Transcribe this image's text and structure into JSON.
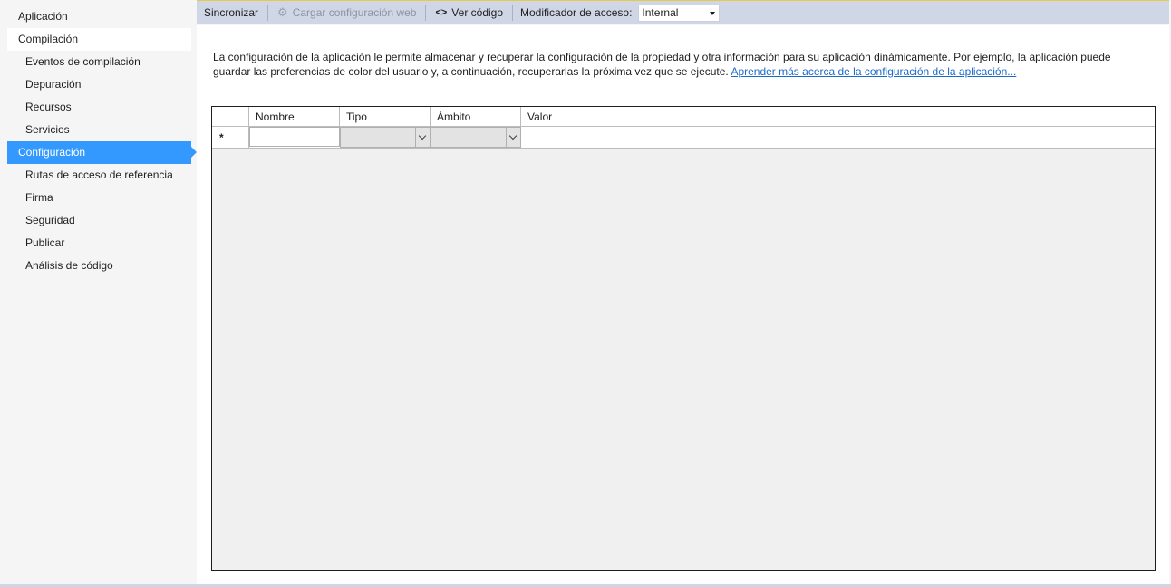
{
  "sidebar": {
    "items": [
      {
        "label": "Aplicación"
      },
      {
        "label": "Compilación"
      },
      {
        "label": "Eventos de compilación"
      },
      {
        "label": "Depuración"
      },
      {
        "label": "Recursos"
      },
      {
        "label": "Servicios"
      },
      {
        "label": "Configuración"
      },
      {
        "label": "Rutas de acceso de referencia"
      },
      {
        "label": "Firma"
      },
      {
        "label": "Seguridad"
      },
      {
        "label": "Publicar"
      },
      {
        "label": "Análisis de código"
      }
    ],
    "selected": "Configuración"
  },
  "toolbar": {
    "sync_label": "Sincronizar",
    "load_web_label": "Cargar configuración web",
    "view_code_icon": "<>",
    "view_code_label": "Ver código",
    "access_modifier_label": "Modificador de acceso:",
    "access_modifier_value": "Internal"
  },
  "description": {
    "text": "La configuración de la aplicación le permite almacenar y recuperar la configuración de la propiedad y otra información para su aplicación dinámicamente. Por ejemplo, la aplicación puede guardar las preferencias de color del usuario y, a continuación, recuperarlas la próxima vez que se ejecute. ",
    "link": " Aprender más acerca de la configuración de la aplicación..."
  },
  "grid": {
    "columns": [
      "Nombre",
      "Tipo",
      "Ámbito",
      "Valor"
    ],
    "new_row_marker": "*"
  },
  "colors": {
    "accent": "#3399ff",
    "toolbar_bg": "#cfd6e5",
    "link": "#1a6ac9"
  }
}
